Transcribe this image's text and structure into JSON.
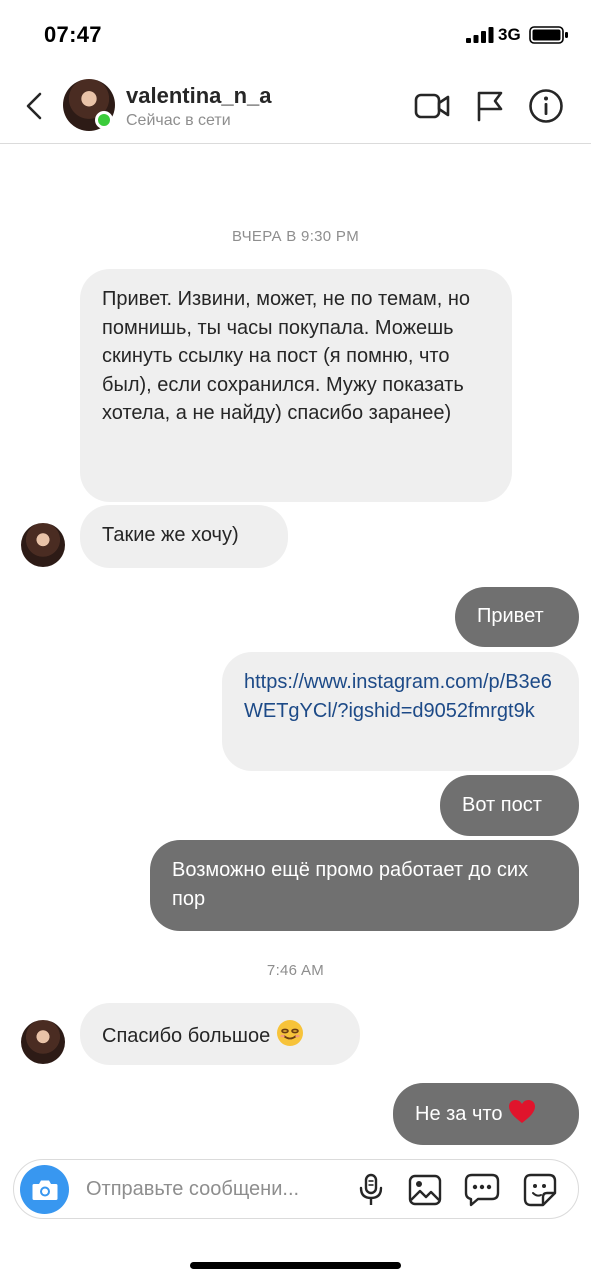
{
  "status_bar": {
    "time": "07:47",
    "network": "3G"
  },
  "header": {
    "username": "valentina_n_a",
    "presence": "Сейчас в сети",
    "icons": [
      "back-chevron-icon",
      "video-call-icon",
      "flag-icon",
      "info-icon"
    ]
  },
  "chat": {
    "timestamp_1": "ВЧЕРА В 9:30 PM",
    "msg_1": "Привет. Извини, может, не по темам, но помнишь, ты часы покупала. Можешь скинуть ссылку на пост (я помню, что был), если сохранился. Мужу показать хотела, а не найду) спасибо заранее)",
    "msg_2": "Такие же хочу)",
    "msg_3": "Привет",
    "msg_4": "https://www.instagram.com/p/B3e6WETgYCl/?igshid=d9052fmrgt9k",
    "msg_5": "Вот пост",
    "msg_6": "Возможно ещё промо работает до сих пор",
    "timestamp_2": "7:46 AM",
    "msg_7": "Спасибо большое",
    "msg_8": "Не за что"
  },
  "composer": {
    "placeholder": "Отправьте сообщени...",
    "icons": [
      "camera-icon",
      "microphone-icon",
      "gallery-icon",
      "chat-bubble-icon",
      "sticker-icon"
    ]
  },
  "colors": {
    "accent": "#3897f0",
    "online": "#3bcc3b",
    "outgoing_bubble": "#707070",
    "incoming_bubble": "#efefef",
    "link": "#1d4a87"
  }
}
